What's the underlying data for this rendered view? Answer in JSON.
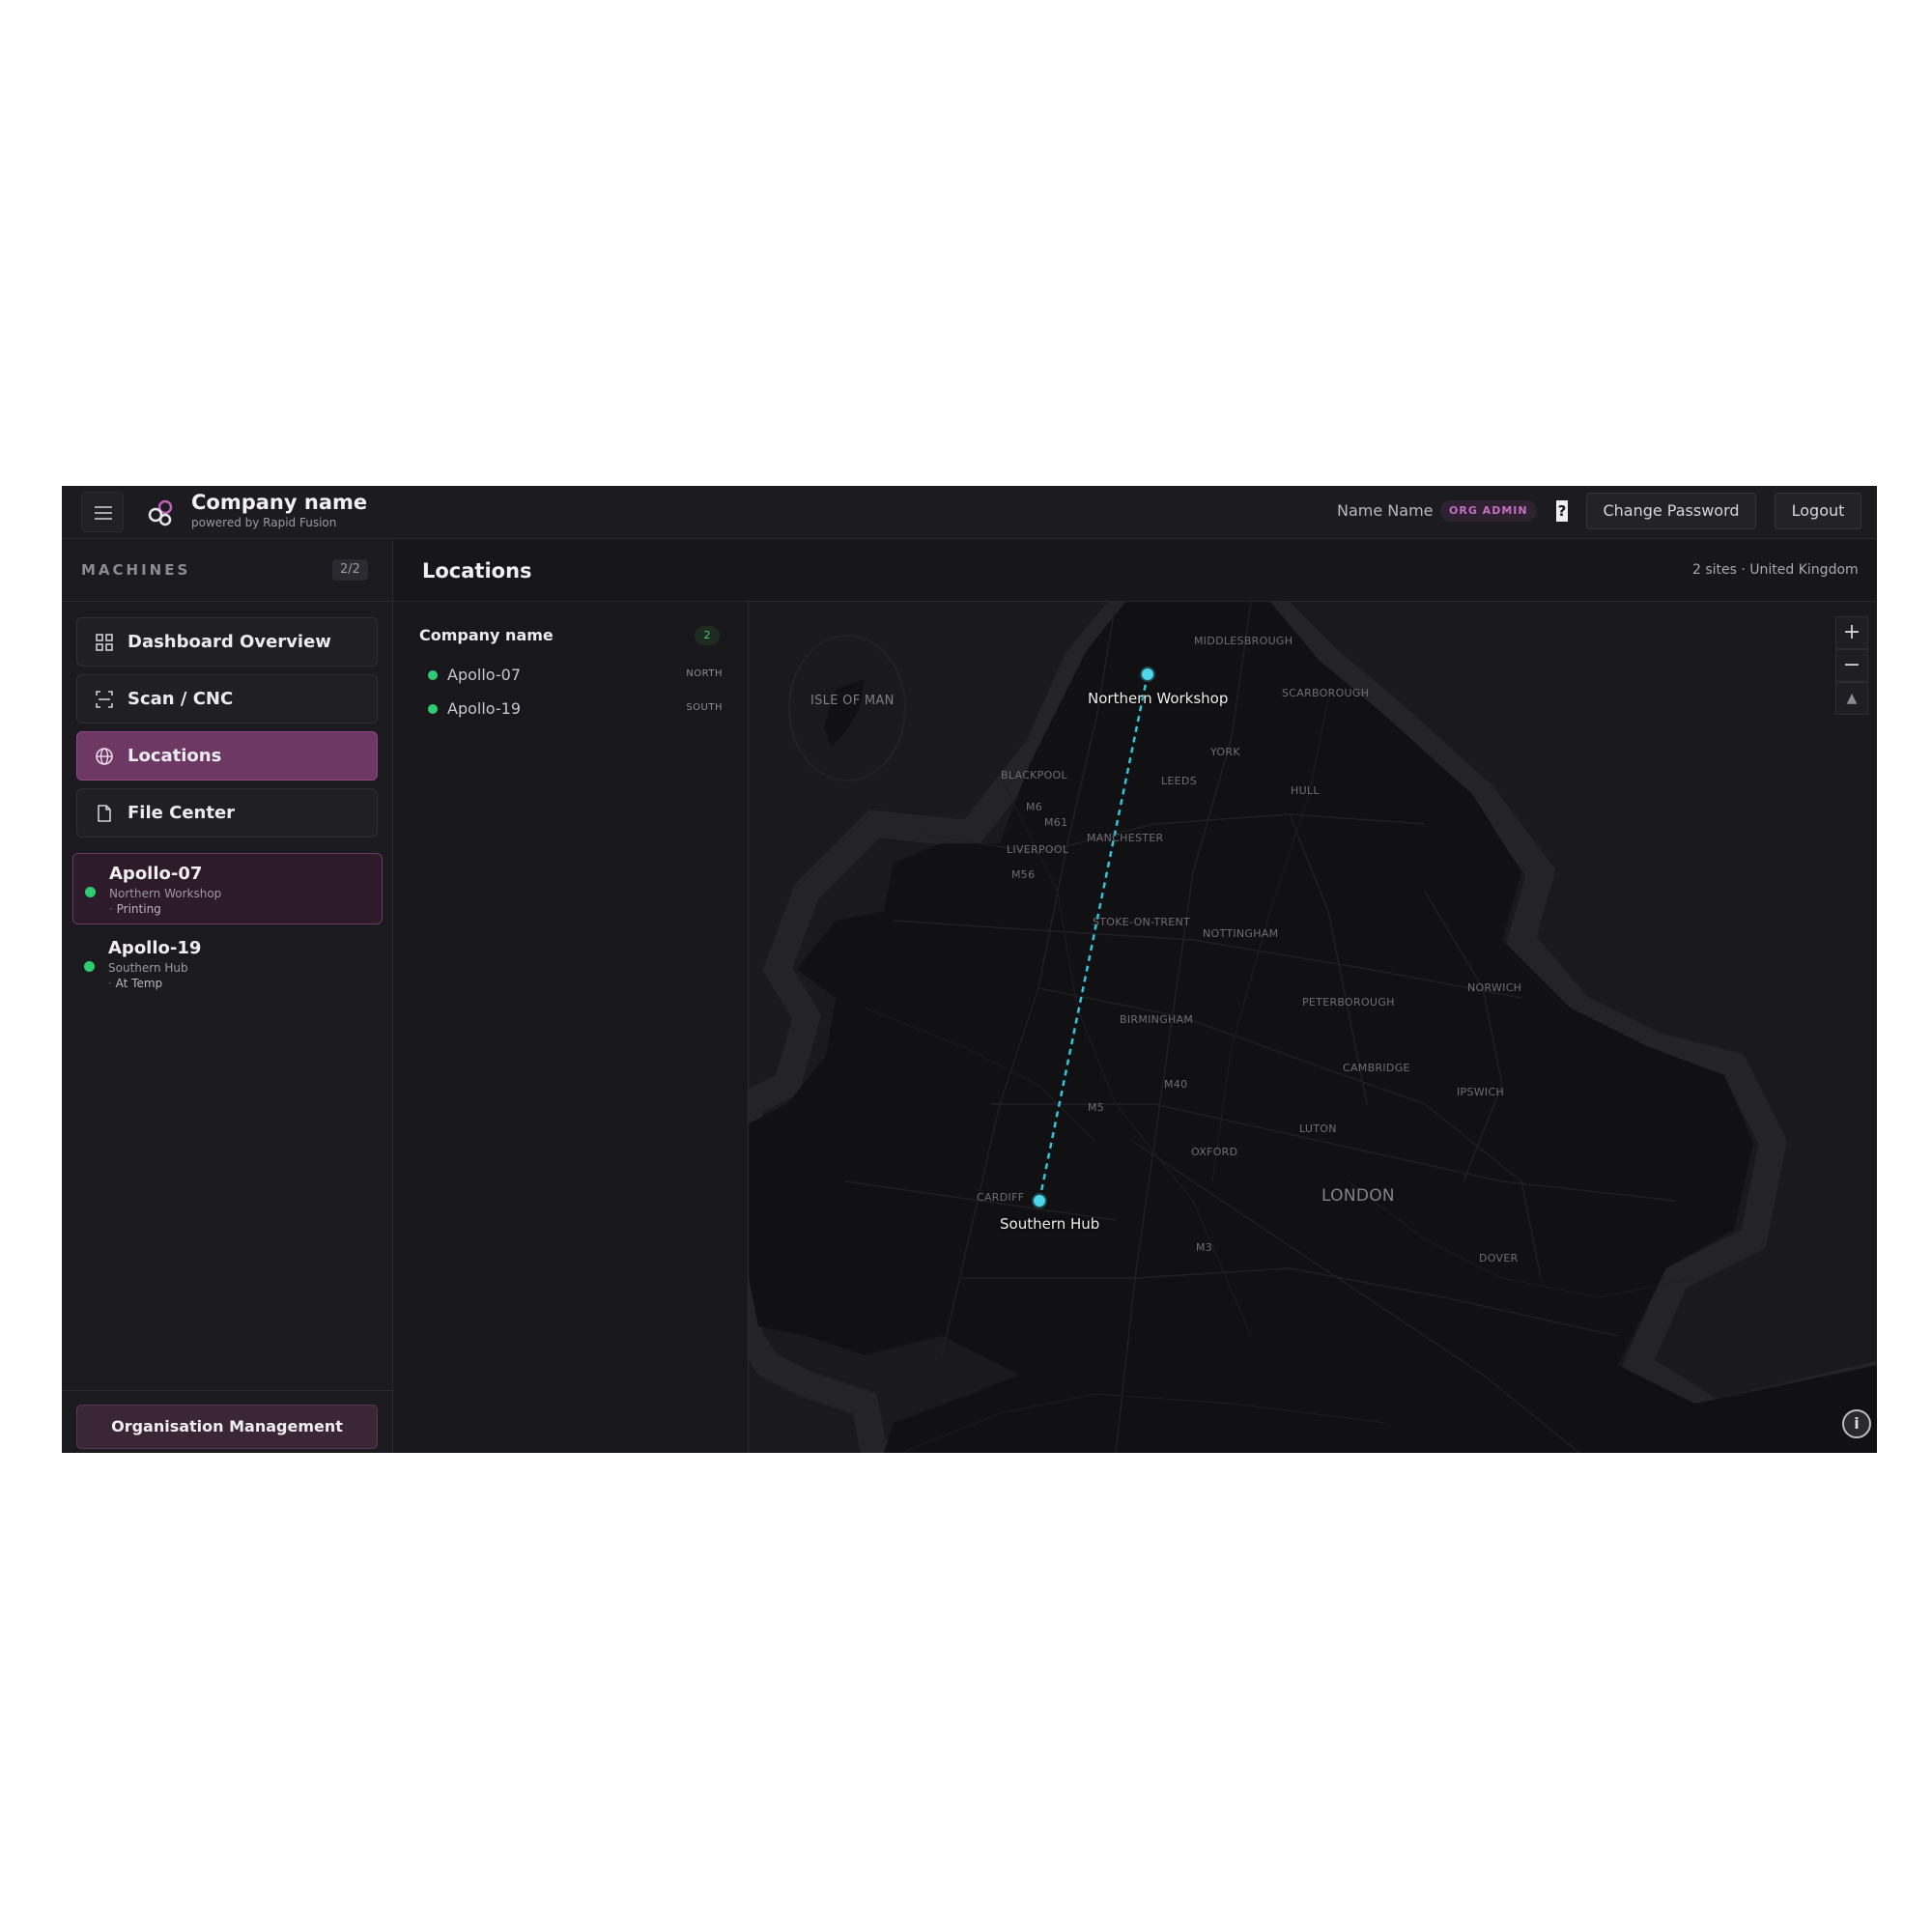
{
  "header": {
    "brand_name": "Company name",
    "brand_sub": "powered by Rapid Fusion",
    "user_name": "Name Name",
    "role_badge": "ORG ADMIN",
    "help_label": "?",
    "change_password_label": "Change Password",
    "logout_label": "Logout"
  },
  "sidebar": {
    "section_label": "MACHINES",
    "count": "2/2",
    "nav": [
      {
        "label": "Dashboard Overview",
        "icon": "grid-icon",
        "active": false
      },
      {
        "label": "Scan / CNC",
        "icon": "scan-icon",
        "active": false
      },
      {
        "label": "Locations",
        "icon": "globe-icon",
        "active": true
      },
      {
        "label": "File Center",
        "icon": "file-icon",
        "active": false
      }
    ],
    "machines": [
      {
        "name": "Apollo-07",
        "location": "Northern Workshop",
        "status": "Printing",
        "status_color": "#2ecc71",
        "selected": true
      },
      {
        "name": "Apollo-19",
        "location": "Southern Hub",
        "status": "At Temp",
        "status_color": "#2ecc71",
        "selected": false
      }
    ],
    "org_management_label": "Organisation Management"
  },
  "main": {
    "title": "Locations",
    "summary": "2 sites · United Kingdom",
    "group": {
      "name": "Company name",
      "count": "2",
      "sites": [
        {
          "name": "Apollo-07",
          "region": "NORTH"
        },
        {
          "name": "Apollo-19",
          "region": "SOUTH"
        }
      ]
    }
  },
  "map": {
    "pins": [
      {
        "label": "Northern Workshop"
      },
      {
        "label": "Southern Hub"
      }
    ],
    "place_labels": [
      "MIDDLESBROUGH",
      "ISLE OF MAN",
      "SCARBOROUGH",
      "YORK",
      "BLACKPOOL",
      "LEEDS",
      "HULL",
      "M6",
      "M61",
      "LIVERPOOL",
      "MANCHESTER",
      "M56",
      "STOKE-ON-TRENT",
      "NOTTINGHAM",
      "NORWICH",
      "PETERBOROUGH",
      "BIRMINGHAM",
      "CAMBRIDGE",
      "M40",
      "IPSWICH",
      "M5",
      "LUTON",
      "OXFORD",
      "CARDIFF",
      "LONDON",
      "M3",
      "DOVER"
    ],
    "zoom_in": "+",
    "zoom_out": "−",
    "compass": "▲",
    "info": "i",
    "accent_color": "#4fd6ea"
  },
  "colors": {
    "accent": "#6d3864",
    "status_online": "#2ecc71",
    "pin": "#4fd6ea"
  }
}
